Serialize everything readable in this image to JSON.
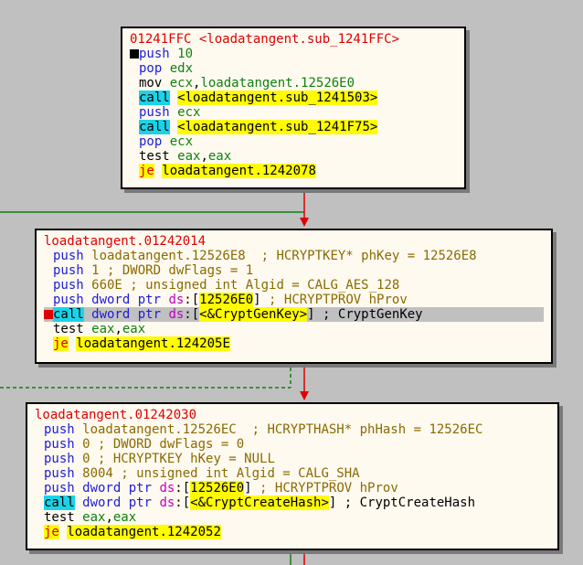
{
  "blocks": [
    {
      "label": "01241FFC <loadatangent.sub_1241FFC>",
      "lines": [
        {
          "mnem": "push",
          "m": "blue",
          "bp": "black",
          "ops": [
            {
              "t": " 10",
              "c": "green"
            }
          ]
        },
        {
          "mnem": "pop",
          "m": "blue",
          "ops": [
            {
              "t": " edx",
              "c": "green"
            }
          ]
        },
        {
          "mnem": "mov",
          "m": "black",
          "ops": [
            {
              "t": " ecx",
              "c": "green"
            },
            {
              "t": ",",
              "c": "black"
            },
            {
              "t": "loadatangent.12526E0",
              "c": "green"
            }
          ]
        },
        {
          "mnem": "call",
          "m": "call",
          "ops": [
            {
              "t": " ",
              "c": "black"
            },
            {
              "t": "<loadatangent.sub_1241503>",
              "c": "yellow"
            }
          ]
        },
        {
          "mnem": "push",
          "m": "blue",
          "ops": [
            {
              "t": " ecx",
              "c": "green"
            }
          ]
        },
        {
          "mnem": "call",
          "m": "call",
          "ops": [
            {
              "t": " ",
              "c": "black"
            },
            {
              "t": "<loadatangent.sub_1241F75>",
              "c": "yellow"
            }
          ]
        },
        {
          "mnem": "pop",
          "m": "blue",
          "ops": [
            {
              "t": " ecx",
              "c": "green"
            }
          ]
        },
        {
          "mnem": "test",
          "m": "black",
          "ops": [
            {
              "t": " eax",
              "c": "green"
            },
            {
              "t": ",",
              "c": "black"
            },
            {
              "t": "eax",
              "c": "green"
            }
          ]
        },
        {
          "mnem": "je",
          "m": "je",
          "ops": [
            {
              "t": " ",
              "c": "black"
            },
            {
              "t": "loadatangent.1242078",
              "c": "yellow"
            }
          ]
        }
      ]
    },
    {
      "label": "loadatangent.01242014",
      "lines": [
        {
          "mnem": "push",
          "m": "blue",
          "ops": [
            {
              "t": " loadatangent.12526E8",
              "c": "olive"
            },
            {
              "t": "  ; HCRYPTKEY* phKey = 12526E8",
              "c": "olive"
            }
          ]
        },
        {
          "mnem": "push",
          "m": "blue",
          "ops": [
            {
              "t": " 1",
              "c": "olive"
            },
            {
              "t": " ; DWORD dwFlags = 1",
              "c": "olive"
            }
          ]
        },
        {
          "mnem": "push",
          "m": "blue",
          "ops": [
            {
              "t": " 660E",
              "c": "olive"
            },
            {
              "t": " ; unsigned int Algid = CALG_AES_128",
              "c": "olive"
            }
          ]
        },
        {
          "mnem": "push",
          "m": "blue",
          "ops": [
            {
              "t": " dword ptr ",
              "c": "blue"
            },
            {
              "t": "ds",
              "c": "mag"
            },
            {
              "t": ":[",
              "c": "black"
            },
            {
              "t": "12526E0",
              "c": "yellow"
            },
            {
              "t": "]",
              "c": "black"
            },
            {
              "t": " ; HCRYPTPROV hProv",
              "c": "olive"
            }
          ]
        },
        {
          "mnem": "call",
          "m": "call",
          "bp": "red",
          "hl": true,
          "ops": [
            {
              "t": " dword ptr ",
              "c": "blue"
            },
            {
              "t": "ds",
              "c": "mag"
            },
            {
              "t": ":[",
              "c": "black"
            },
            {
              "t": "<&CryptGenKey>",
              "c": "yellow"
            },
            {
              "t": "] ; CryptGenKey",
              "c": "black"
            }
          ]
        },
        {
          "mnem": "test",
          "m": "black",
          "ops": [
            {
              "t": " eax",
              "c": "green"
            },
            {
              "t": ",",
              "c": "black"
            },
            {
              "t": "eax",
              "c": "green"
            }
          ]
        },
        {
          "mnem": "je",
          "m": "je",
          "ops": [
            {
              "t": " ",
              "c": "black"
            },
            {
              "t": "loadatangent.124205E",
              "c": "yellow"
            }
          ]
        }
      ]
    },
    {
      "label": "loadatangent.01242030",
      "lines": [
        {
          "mnem": "push",
          "m": "blue",
          "ops": [
            {
              "t": " loadatangent.12526EC",
              "c": "olive"
            },
            {
              "t": "  ; HCRYPTHASH* phHash = 12526EC",
              "c": "olive"
            }
          ]
        },
        {
          "mnem": "push",
          "m": "blue",
          "ops": [
            {
              "t": " 0",
              "c": "olive"
            },
            {
              "t": " ; DWORD dwFlags = 0",
              "c": "olive"
            }
          ]
        },
        {
          "mnem": "push",
          "m": "blue",
          "ops": [
            {
              "t": " 0",
              "c": "olive"
            },
            {
              "t": " ; HCRYPTKEY hKey = NULL",
              "c": "olive"
            }
          ]
        },
        {
          "mnem": "push",
          "m": "blue",
          "ops": [
            {
              "t": " 8004",
              "c": "olive"
            },
            {
              "t": " ; unsigned int Algid = CALG_SHA",
              "c": "olive"
            }
          ]
        },
        {
          "mnem": "push",
          "m": "blue",
          "ops": [
            {
              "t": " dword ptr ",
              "c": "blue"
            },
            {
              "t": "ds",
              "c": "mag"
            },
            {
              "t": ":[",
              "c": "black"
            },
            {
              "t": "12526E0",
              "c": "yellow"
            },
            {
              "t": "]",
              "c": "black"
            },
            {
              "t": " ; HCRYPTPROV hProv",
              "c": "olive"
            }
          ]
        },
        {
          "mnem": "call",
          "m": "call",
          "ops": [
            {
              "t": " dword ptr ",
              "c": "blue"
            },
            {
              "t": "ds",
              "c": "mag"
            },
            {
              "t": ":[",
              "c": "black"
            },
            {
              "t": "<&CryptCreateHash>",
              "c": "yellow"
            },
            {
              "t": "] ; CryptCreateHash",
              "c": "black"
            }
          ]
        },
        {
          "mnem": "test",
          "m": "black",
          "ops": [
            {
              "t": " eax",
              "c": "green"
            },
            {
              "t": ",",
              "c": "black"
            },
            {
              "t": "eax",
              "c": "green"
            }
          ]
        },
        {
          "mnem": "je",
          "m": "je",
          "ops": [
            {
              "t": " ",
              "c": "black"
            },
            {
              "t": "loadatangent.1242052",
              "c": "yellow"
            }
          ]
        }
      ]
    }
  ]
}
